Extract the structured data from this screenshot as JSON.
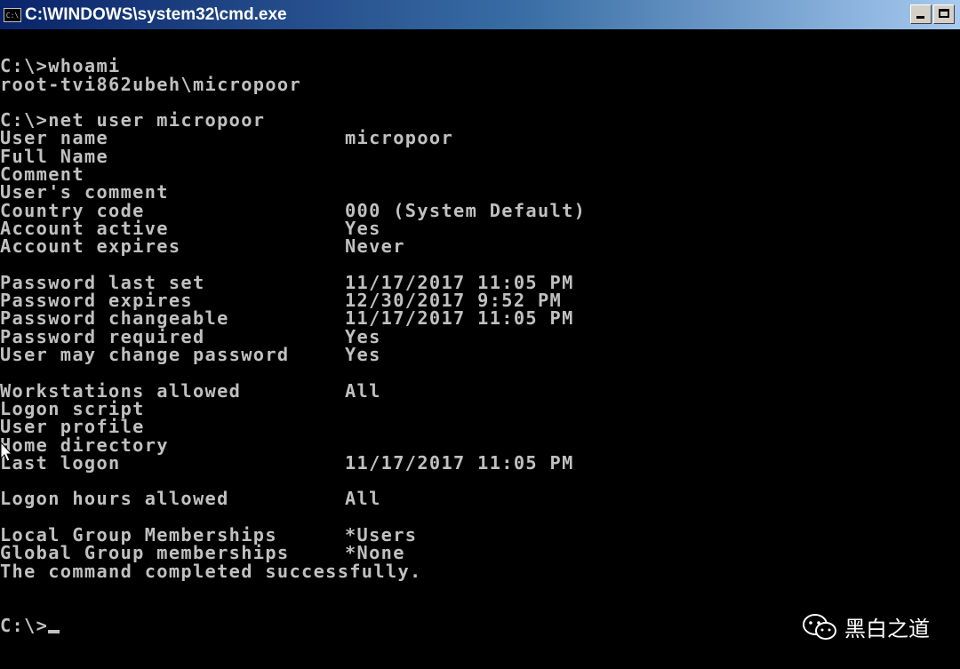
{
  "window": {
    "title": "C:\\WINDOWS\\system32\\cmd.exe",
    "icon_label": "C:\\"
  },
  "console": {
    "lines": [
      {
        "type": "blank"
      },
      {
        "type": "text",
        "text": "C:\\>whoami"
      },
      {
        "type": "text",
        "text": "root-tvi862ubeh\\micropoor"
      },
      {
        "type": "blank"
      },
      {
        "type": "text",
        "text": "C:\\>net user micropoor"
      },
      {
        "type": "pair",
        "label": "User name",
        "value": "micropoor"
      },
      {
        "type": "pair",
        "label": "Full Name",
        "value": ""
      },
      {
        "type": "pair",
        "label": "Comment",
        "value": ""
      },
      {
        "type": "pair",
        "label": "User's comment",
        "value": ""
      },
      {
        "type": "pair",
        "label": "Country code",
        "value": "000 (System Default)"
      },
      {
        "type": "pair",
        "label": "Account active",
        "value": "Yes"
      },
      {
        "type": "pair",
        "label": "Account expires",
        "value": "Never"
      },
      {
        "type": "blank"
      },
      {
        "type": "pair",
        "label": "Password last set",
        "value": "11/17/2017 11:05 PM"
      },
      {
        "type": "pair",
        "label": "Password expires",
        "value": "12/30/2017 9:52 PM"
      },
      {
        "type": "pair",
        "label": "Password changeable",
        "value": "11/17/2017 11:05 PM"
      },
      {
        "type": "pair",
        "label": "Password required",
        "value": "Yes"
      },
      {
        "type": "pair",
        "label": "User may change password",
        "value": "Yes"
      },
      {
        "type": "blank"
      },
      {
        "type": "pair",
        "label": "Workstations allowed",
        "value": "All"
      },
      {
        "type": "pair",
        "label": "Logon script",
        "value": ""
      },
      {
        "type": "pair",
        "label": "User profile",
        "value": ""
      },
      {
        "type": "pair",
        "label": "Home directory",
        "value": ""
      },
      {
        "type": "pair",
        "label": "Last logon",
        "value": "11/17/2017 11:05 PM"
      },
      {
        "type": "blank"
      },
      {
        "type": "pair",
        "label": "Logon hours allowed",
        "value": "All"
      },
      {
        "type": "blank"
      },
      {
        "type": "pair",
        "label": "Local Group Memberships",
        "value": "*Users"
      },
      {
        "type": "pair",
        "label": "Global Group memberships",
        "value": "*None"
      },
      {
        "type": "text",
        "text": "The command completed successfully."
      },
      {
        "type": "blank"
      },
      {
        "type": "blank"
      },
      {
        "type": "prompt",
        "text": "C:\\>"
      }
    ]
  },
  "watermark": {
    "text": "黑白之道",
    "icon": "wechat-icon"
  },
  "colors": {
    "console_bg": "#000000",
    "console_fg": "#c0c0c0",
    "titlebar_start": "#0a246a",
    "titlebar_end": "#a6caf0"
  }
}
